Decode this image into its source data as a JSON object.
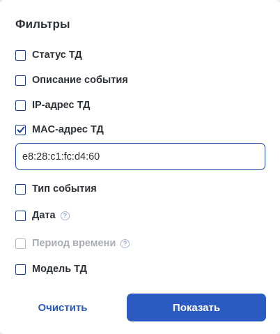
{
  "panel": {
    "title": "Фильтры"
  },
  "filters": [
    {
      "label": "Статус ТД",
      "checked": false,
      "disabled": false,
      "help": false
    },
    {
      "label": "Описание события",
      "checked": false,
      "disabled": false,
      "help": false
    },
    {
      "label": "IP-адрес ТД",
      "checked": false,
      "disabled": false,
      "help": false
    },
    {
      "label": "MAC-адрес ТД",
      "checked": true,
      "disabled": false,
      "help": false
    },
    {
      "label": "Тип события",
      "checked": false,
      "disabled": false,
      "help": false
    },
    {
      "label": "Дата",
      "checked": false,
      "disabled": false,
      "help": true,
      "help_icon": "question-circle-icon",
      "help_glyph": "?"
    },
    {
      "label": "Период времени",
      "checked": false,
      "disabled": true,
      "help": true,
      "help_icon": "question-circle-icon",
      "help_glyph": "?"
    },
    {
      "label": "Модель ТД",
      "checked": false,
      "disabled": false,
      "help": false
    }
  ],
  "mac_input": {
    "value": "e8:28:c1:fc:d4:60"
  },
  "actions": {
    "clear_label": "Очистить",
    "show_label": "Показать"
  },
  "colors": {
    "accent": "#2b5bc0",
    "checkbox_border": "#1f3f8f",
    "disabled": "#b7bcc4",
    "help_icon": "#9fb3d9"
  }
}
